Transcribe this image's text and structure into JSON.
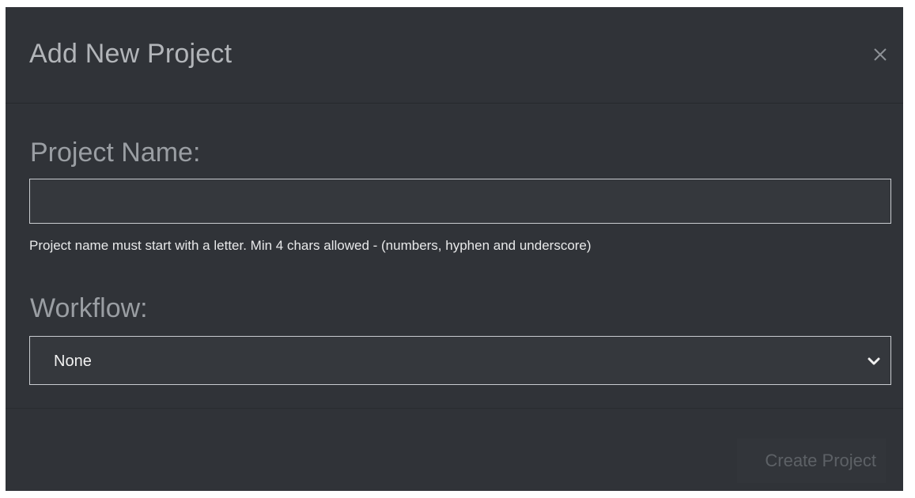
{
  "dialog": {
    "title": "Add New Project",
    "close_icon": "close-icon"
  },
  "form": {
    "project_name_label": "Project Name:",
    "project_name_value": "",
    "project_name_help": "Project name must start with a letter. Min 4 chars allowed - (numbers, hyphen and underscore)",
    "workflow_label": "Workflow:",
    "workflow_selected": "None",
    "workflow_icon": "chevron-down-icon"
  },
  "footer": {
    "create_label": "Create Project",
    "create_disabled": true
  },
  "colors": {
    "dialog_bg": "#303338",
    "input_border": "#c9ccd0",
    "title_text": "#b2b5b9",
    "disabled_text": "#5d6166"
  }
}
